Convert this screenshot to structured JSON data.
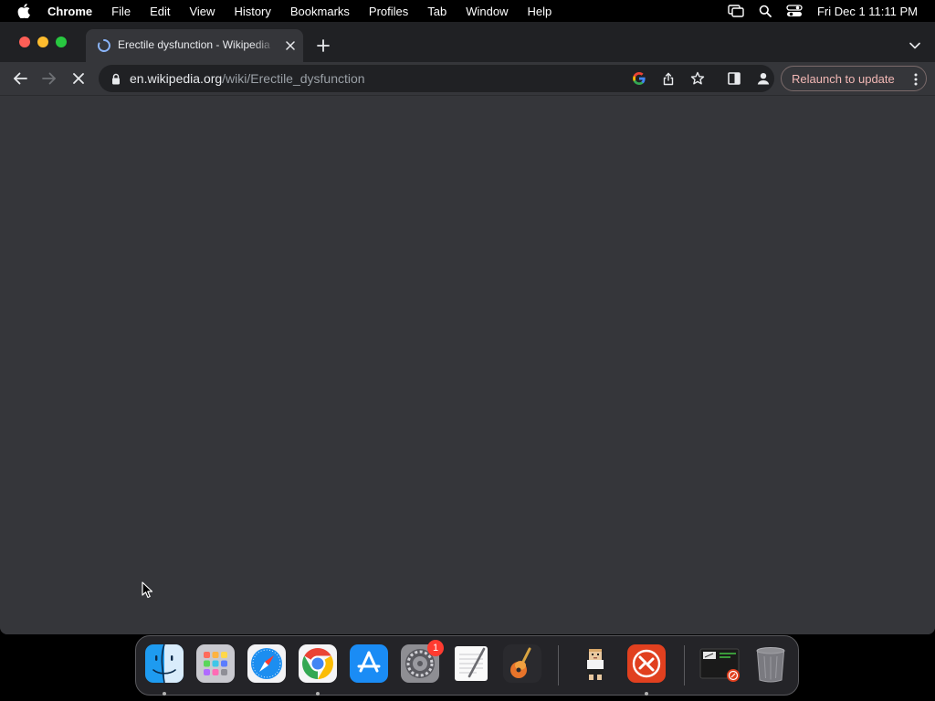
{
  "menubar": {
    "app_name": "Chrome",
    "menus": [
      "File",
      "Edit",
      "View",
      "History",
      "Bookmarks",
      "Profiles",
      "Tab",
      "Window",
      "Help"
    ],
    "clock": "Fri Dec 1  11:11 PM",
    "tray_icons": [
      "screen-mirroring-icon",
      "spotlight-search-icon",
      "control-center-icon"
    ]
  },
  "tab": {
    "title": "Erectile dysfunction - Wikipedia",
    "loading": true
  },
  "toolbar": {
    "url_host": "en.wikipedia.org",
    "url_path": "/wiki/Erectile_dysfunction",
    "relaunch_label": "Relaunch to update"
  },
  "colors": {
    "menubar_bg": "#000000",
    "tabstrip_bg": "#202124",
    "toolbar_bg": "#35363a",
    "omnibox_bg": "#202124",
    "content_bg": "#35363a",
    "relaunch_text": "#f2b8b5",
    "close_button": "#ff5f57",
    "minimize_button": "#febc2e",
    "maximize_button": "#28c840"
  },
  "dock": {
    "items": [
      {
        "name": "Finder",
        "icon": "finder-icon",
        "running": true
      },
      {
        "name": "Launchpad",
        "icon": "launchpad-icon",
        "running": false
      },
      {
        "name": "Safari",
        "icon": "safari-icon",
        "running": false
      },
      {
        "name": "Google Chrome",
        "icon": "chrome-icon",
        "running": true
      },
      {
        "name": "App Store",
        "icon": "app-store-icon",
        "running": false
      },
      {
        "name": "System Preferences",
        "icon": "system-preferences-icon",
        "running": false,
        "badge": "1"
      },
      {
        "name": "TextEdit",
        "icon": "textedit-icon",
        "running": false
      },
      {
        "name": "GarageBand",
        "icon": "garageband-icon",
        "running": false
      },
      {
        "name": "Pixel character app",
        "icon": "pixel-character-icon",
        "running": false
      },
      {
        "name": "Remote Desktop",
        "icon": "remote-desktop-icon",
        "running": true
      },
      {
        "name": "Recent window",
        "icon": "minimized-window-icon",
        "running": false
      },
      {
        "name": "Trash",
        "icon": "trash-icon",
        "running": false
      }
    ]
  }
}
